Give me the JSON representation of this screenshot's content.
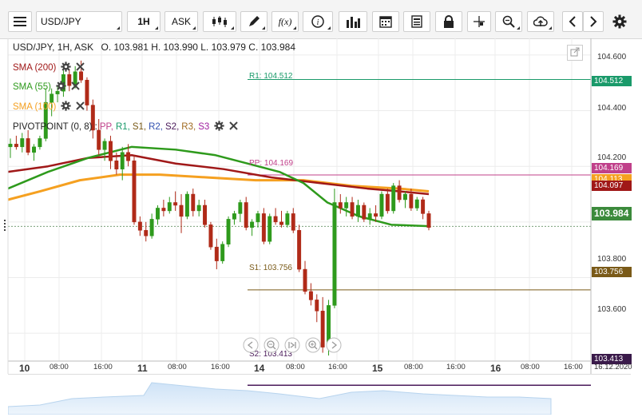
{
  "toolbar": {
    "symbol": "USD/JPY",
    "timeframe": "1H",
    "price_type": "ASK",
    "fx_label": "f(x)"
  },
  "header": {
    "instrument": "USD/JPY, 1H, ASK",
    "ohlc": "O. 103.981 H. 103.990 L. 103.979 C. 103.984"
  },
  "legend": {
    "sma200": "SMA (200)",
    "sma55": "SMA (55)",
    "sma100": "SMA (100)",
    "pivot_prefix": "PIVOTPOINT (0, 8) :",
    "pivot_items": [
      "PP,",
      "R1,",
      "S1,",
      "R2,",
      "S2,",
      "R3,",
      "S3"
    ]
  },
  "colors": {
    "sma200": "#a01818",
    "sma55": "#2e9a1c",
    "sma100": "#f5a020",
    "pp": "#c0408a",
    "r1": "#1a9a6a",
    "s1": "#7a5a18",
    "s2": "#4a1a5a",
    "r2": "#3050b0",
    "r3": "#a06a20",
    "s3": "#a020a0",
    "bull": "#2e9a1c",
    "bear": "#b02a18",
    "current": "#3b8a3b"
  },
  "lines": {
    "r1": "R1: 104.512",
    "pp": "PP: 104.169",
    "s1": "S1: 103.756",
    "s2": "S2: 103.413"
  },
  "price_axis": [
    "104.600",
    "104.400",
    "104.200",
    "103.800",
    "103.600"
  ],
  "price_tags": {
    "r1": "104.512",
    "pp": "104.169",
    "sma100": "104.113",
    "sma200": "104.097",
    "current": "103.984",
    "s1": "103.756",
    "s2": "103.413"
  },
  "time_axis": [
    {
      "t": "10",
      "bold": true
    },
    {
      "t": "08:00"
    },
    {
      "t": "16:00"
    },
    {
      "t": "11",
      "bold": true
    },
    {
      "t": "08:00"
    },
    {
      "t": "16:00"
    },
    {
      "t": "14",
      "bold": true
    },
    {
      "t": "08:00"
    },
    {
      "t": "16:00"
    },
    {
      "t": "15",
      "bold": true
    },
    {
      "t": "08:00"
    },
    {
      "t": "16:00"
    },
    {
      "t": "16",
      "bold": true
    },
    {
      "t": "08:00"
    },
    {
      "t": "16:00"
    },
    {
      "t": "16.12.2020"
    }
  ],
  "chart_data": {
    "type": "candlestick",
    "ylim": [
      103.5,
      104.66
    ],
    "candles": [
      [
        104.27,
        104.3,
        104.23,
        104.28
      ],
      [
        104.28,
        104.31,
        104.26,
        104.27
      ],
      [
        104.27,
        104.32,
        104.25,
        104.3
      ],
      [
        104.3,
        104.33,
        104.24,
        104.25
      ],
      [
        104.25,
        104.28,
        104.22,
        104.27
      ],
      [
        104.27,
        104.31,
        104.26,
        104.3
      ],
      [
        104.3,
        104.48,
        104.29,
        104.43
      ],
      [
        104.43,
        104.48,
        104.38,
        104.46
      ],
      [
        104.46,
        104.49,
        104.43,
        104.47
      ],
      [
        104.47,
        104.56,
        104.45,
        104.53
      ],
      [
        104.53,
        104.55,
        104.47,
        104.49
      ],
      [
        104.49,
        104.56,
        104.48,
        104.54
      ],
      [
        104.54,
        104.58,
        104.5,
        104.51
      ],
      [
        104.51,
        104.52,
        104.4,
        104.42
      ],
      [
        104.42,
        104.44,
        104.3,
        104.33
      ],
      [
        104.33,
        104.37,
        104.24,
        104.26
      ],
      [
        104.26,
        104.3,
        104.22,
        104.29
      ],
      [
        104.29,
        104.31,
        104.19,
        104.22
      ],
      [
        104.22,
        104.25,
        104.17,
        104.19
      ],
      [
        104.19,
        104.27,
        104.15,
        104.25
      ],
      [
        104.25,
        104.28,
        104.2,
        104.22
      ],
      [
        104.22,
        104.24,
        103.99,
        104.0
      ],
      [
        104.0,
        104.02,
        103.95,
        103.97
      ],
      [
        103.97,
        104.0,
        103.93,
        103.95
      ],
      [
        103.95,
        104.03,
        103.94,
        104.01
      ],
      [
        104.01,
        104.06,
        103.99,
        104.05
      ],
      [
        104.05,
        104.08,
        104.02,
        104.04
      ],
      [
        104.04,
        104.09,
        104.03,
        104.07
      ],
      [
        104.07,
        104.11,
        104.04,
        104.06
      ],
      [
        104.06,
        104.1,
        103.96,
        104.02
      ],
      [
        104.02,
        104.11,
        104.01,
        104.1
      ],
      [
        104.1,
        104.12,
        104.02,
        104.04
      ],
      [
        104.04,
        104.08,
        104.02,
        104.06
      ],
      [
        104.06,
        104.08,
        103.98,
        103.99
      ],
      [
        103.99,
        104.0,
        103.9,
        103.91
      ],
      [
        103.91,
        103.94,
        103.83,
        103.86
      ],
      [
        103.86,
        103.93,
        103.85,
        103.92
      ],
      [
        103.92,
        104.02,
        103.91,
        104.01
      ],
      [
        104.01,
        104.04,
        103.99,
        104.03
      ],
      [
        104.03,
        104.08,
        104.0,
        104.07
      ],
      [
        104.07,
        104.09,
        103.97,
        103.98
      ],
      [
        103.98,
        104.01,
        103.95,
        104.0
      ],
      [
        104.0,
        104.04,
        103.98,
        104.03
      ],
      [
        104.03,
        104.05,
        103.92,
        103.93
      ],
      [
        103.93,
        104.03,
        103.92,
        104.02
      ],
      [
        104.02,
        104.05,
        103.99,
        104.0
      ],
      [
        104.0,
        104.04,
        103.98,
        103.99
      ],
      [
        103.99,
        104.04,
        103.98,
        104.03
      ],
      [
        104.03,
        104.05,
        103.96,
        103.97
      ],
      [
        103.97,
        103.99,
        103.82,
        103.83
      ],
      [
        103.83,
        103.86,
        103.74,
        103.75
      ],
      [
        103.75,
        103.78,
        103.7,
        103.72
      ],
      [
        103.72,
        103.74,
        103.64,
        103.68
      ],
      [
        103.68,
        103.73,
        103.53,
        103.55
      ],
      [
        103.55,
        103.72,
        103.52,
        103.7
      ],
      [
        103.7,
        104.12,
        103.69,
        104.07
      ],
      [
        104.07,
        104.1,
        104.03,
        104.05
      ],
      [
        104.05,
        104.09,
        104.02,
        104.07
      ],
      [
        104.07,
        104.09,
        104.01,
        104.02
      ],
      [
        104.02,
        104.08,
        104.0,
        104.06
      ],
      [
        104.06,
        104.07,
        104.0,
        104.01
      ],
      [
        104.01,
        104.05,
        103.99,
        104.03
      ],
      [
        104.03,
        104.06,
        104.0,
        104.02
      ],
      [
        104.02,
        104.11,
        104.01,
        104.1
      ],
      [
        104.1,
        104.12,
        104.03,
        104.04
      ],
      [
        104.04,
        104.14,
        104.03,
        104.13
      ],
      [
        104.13,
        104.15,
        104.07,
        104.08
      ],
      [
        104.08,
        104.11,
        104.05,
        104.1
      ],
      [
        104.1,
        104.12,
        104.04,
        104.05
      ],
      [
        104.05,
        104.09,
        104.04,
        104.08
      ],
      [
        104.08,
        104.09,
        104.01,
        104.03
      ],
      [
        104.03,
        104.04,
        103.97,
        103.98
      ]
    ],
    "sma200": [
      [
        10,
        104.18
      ],
      [
        60,
        104.2
      ],
      [
        110,
        104.23
      ],
      [
        165,
        104.24
      ],
      [
        220,
        104.21
      ],
      [
        280,
        104.19
      ],
      [
        340,
        104.16
      ],
      [
        400,
        104.14
      ],
      [
        460,
        104.12
      ],
      [
        500,
        104.11
      ],
      [
        537,
        104.1
      ]
    ],
    "sma100": [
      [
        10,
        104.08
      ],
      [
        50,
        104.11
      ],
      [
        100,
        104.15
      ],
      [
        150,
        104.17
      ],
      [
        200,
        104.17
      ],
      [
        260,
        104.16
      ],
      [
        320,
        104.15
      ],
      [
        380,
        104.15
      ],
      [
        440,
        104.13
      ],
      [
        500,
        104.12
      ],
      [
        537,
        104.11
      ]
    ],
    "sma55": [
      [
        10,
        104.12
      ],
      [
        60,
        104.18
      ],
      [
        110,
        104.23
      ],
      [
        165,
        104.27
      ],
      [
        220,
        104.26
      ],
      [
        270,
        104.24
      ],
      [
        310,
        104.21
      ],
      [
        350,
        104.18
      ],
      [
        380,
        104.14
      ],
      [
        410,
        104.07
      ],
      [
        450,
        104.02
      ],
      [
        490,
        103.99
      ],
      [
        537,
        103.985
      ]
    ]
  }
}
